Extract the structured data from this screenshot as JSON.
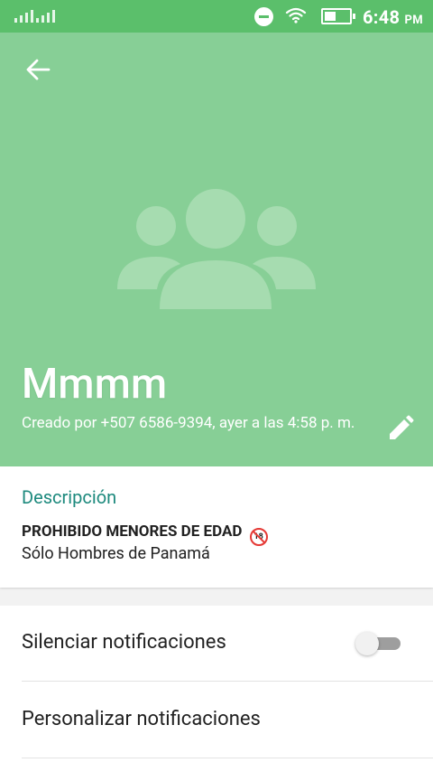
{
  "status_bar": {
    "time": "6:48",
    "ampm": "PM",
    "icons": [
      "signal-icon",
      "do-not-disturb-icon",
      "wifi-icon",
      "battery-icon"
    ]
  },
  "header": {
    "back_icon": "arrow-left-icon",
    "group_avatar_icon": "group-icon",
    "group_name": "Mmmm",
    "created_text": "Creado por +507 6586-9394, ayer a las 4:58 p. m.",
    "edit_icon": "pencil-icon"
  },
  "description": {
    "title": "Descripción",
    "line1": "PROHIBIDO MENORES DE EDAD",
    "line1_emoji_label": "18",
    "line2": "Sólo Hombres de Panamá"
  },
  "settings": {
    "mute_label": "Silenciar notificaciones",
    "mute_enabled": false,
    "custom_label": "Personalizar notificaciones"
  },
  "colors": {
    "status_bar": "#5bbf6b",
    "header": "#87cf96",
    "accent_text": "#1e8a7e",
    "background": "#f2f2f2"
  }
}
